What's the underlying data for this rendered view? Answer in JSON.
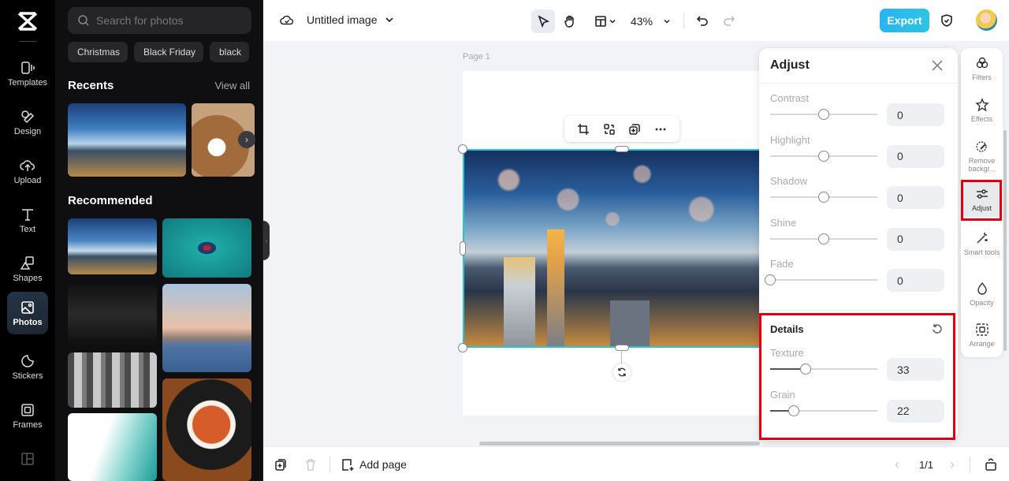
{
  "rail": {
    "items": [
      {
        "label": "Templates",
        "icon": "templates-icon"
      },
      {
        "label": "Design",
        "icon": "design-icon"
      },
      {
        "label": "Upload",
        "icon": "upload-icon"
      },
      {
        "label": "Text",
        "icon": "text-icon"
      },
      {
        "label": "Shapes",
        "icon": "shapes-icon"
      },
      {
        "label": "Photos",
        "icon": "photos-icon",
        "active": true
      },
      {
        "label": "Stickers",
        "icon": "stickers-icon"
      },
      {
        "label": "Frames",
        "icon": "frames-icon"
      }
    ]
  },
  "panel": {
    "search_placeholder": "Search for photos",
    "chips": [
      "Christmas",
      "Black Friday",
      "black"
    ],
    "recents_title": "Recents",
    "view_all": "View all",
    "recommended_title": "Recommended"
  },
  "topbar": {
    "title": "Untitled image",
    "zoom": "43%",
    "export_label": "Export"
  },
  "canvas": {
    "page_label": "Page 1"
  },
  "bottombar": {
    "add_page": "Add page",
    "page_indicator": "1/1"
  },
  "adjust": {
    "title": "Adjust",
    "rows": [
      {
        "label": "Contrast",
        "value": "0",
        "fraction": 0.5
      },
      {
        "label": "Highlight",
        "value": "0",
        "fraction": 0.5
      },
      {
        "label": "Shadow",
        "value": "0",
        "fraction": 0.5
      },
      {
        "label": "Shine",
        "value": "0",
        "fraction": 0.5
      },
      {
        "label": "Fade",
        "value": "0",
        "fraction": 0.0
      }
    ],
    "details": {
      "title": "Details",
      "rows": [
        {
          "label": "Texture",
          "value": "33",
          "fraction": 0.33
        },
        {
          "label": "Grain",
          "value": "22",
          "fraction": 0.22
        }
      ]
    }
  },
  "props": {
    "items": [
      {
        "label": "Filters"
      },
      {
        "label": "Effects"
      },
      {
        "label": "Remove backgr..."
      },
      {
        "label": "Adjust",
        "active": true
      },
      {
        "label": "Smart tools"
      },
      {
        "label": "Opacity"
      },
      {
        "label": "Arrange"
      }
    ]
  }
}
